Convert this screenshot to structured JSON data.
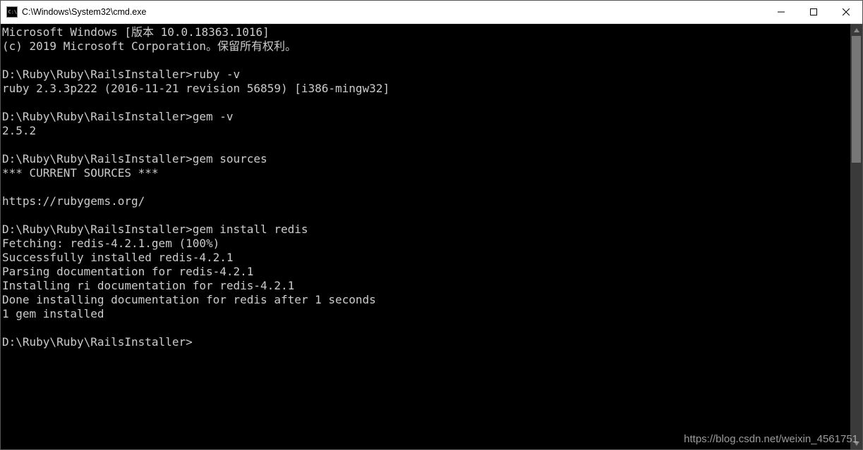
{
  "window": {
    "title": "C:\\Windows\\System32\\cmd.exe"
  },
  "console": {
    "lines": [
      "Microsoft Windows [版本 10.0.18363.1016]",
      "(c) 2019 Microsoft Corporation。保留所有权利。",
      "",
      "D:\\Ruby\\Ruby\\RailsInstaller>ruby -v",
      "ruby 2.3.3p222 (2016-11-21 revision 56859) [i386-mingw32]",
      "",
      "D:\\Ruby\\Ruby\\RailsInstaller>gem -v",
      "2.5.2",
      "",
      "D:\\Ruby\\Ruby\\RailsInstaller>gem sources",
      "*** CURRENT SOURCES ***",
      "",
      "https://rubygems.org/",
      "",
      "D:\\Ruby\\Ruby\\RailsInstaller>gem install redis",
      "Fetching: redis-4.2.1.gem (100%)",
      "Successfully installed redis-4.2.1",
      "Parsing documentation for redis-4.2.1",
      "Installing ri documentation for redis-4.2.1",
      "Done installing documentation for redis after 1 seconds",
      "1 gem installed",
      "",
      "D:\\Ruby\\Ruby\\RailsInstaller>"
    ]
  },
  "watermark": "https://blog.csdn.net/weixin_4561751"
}
